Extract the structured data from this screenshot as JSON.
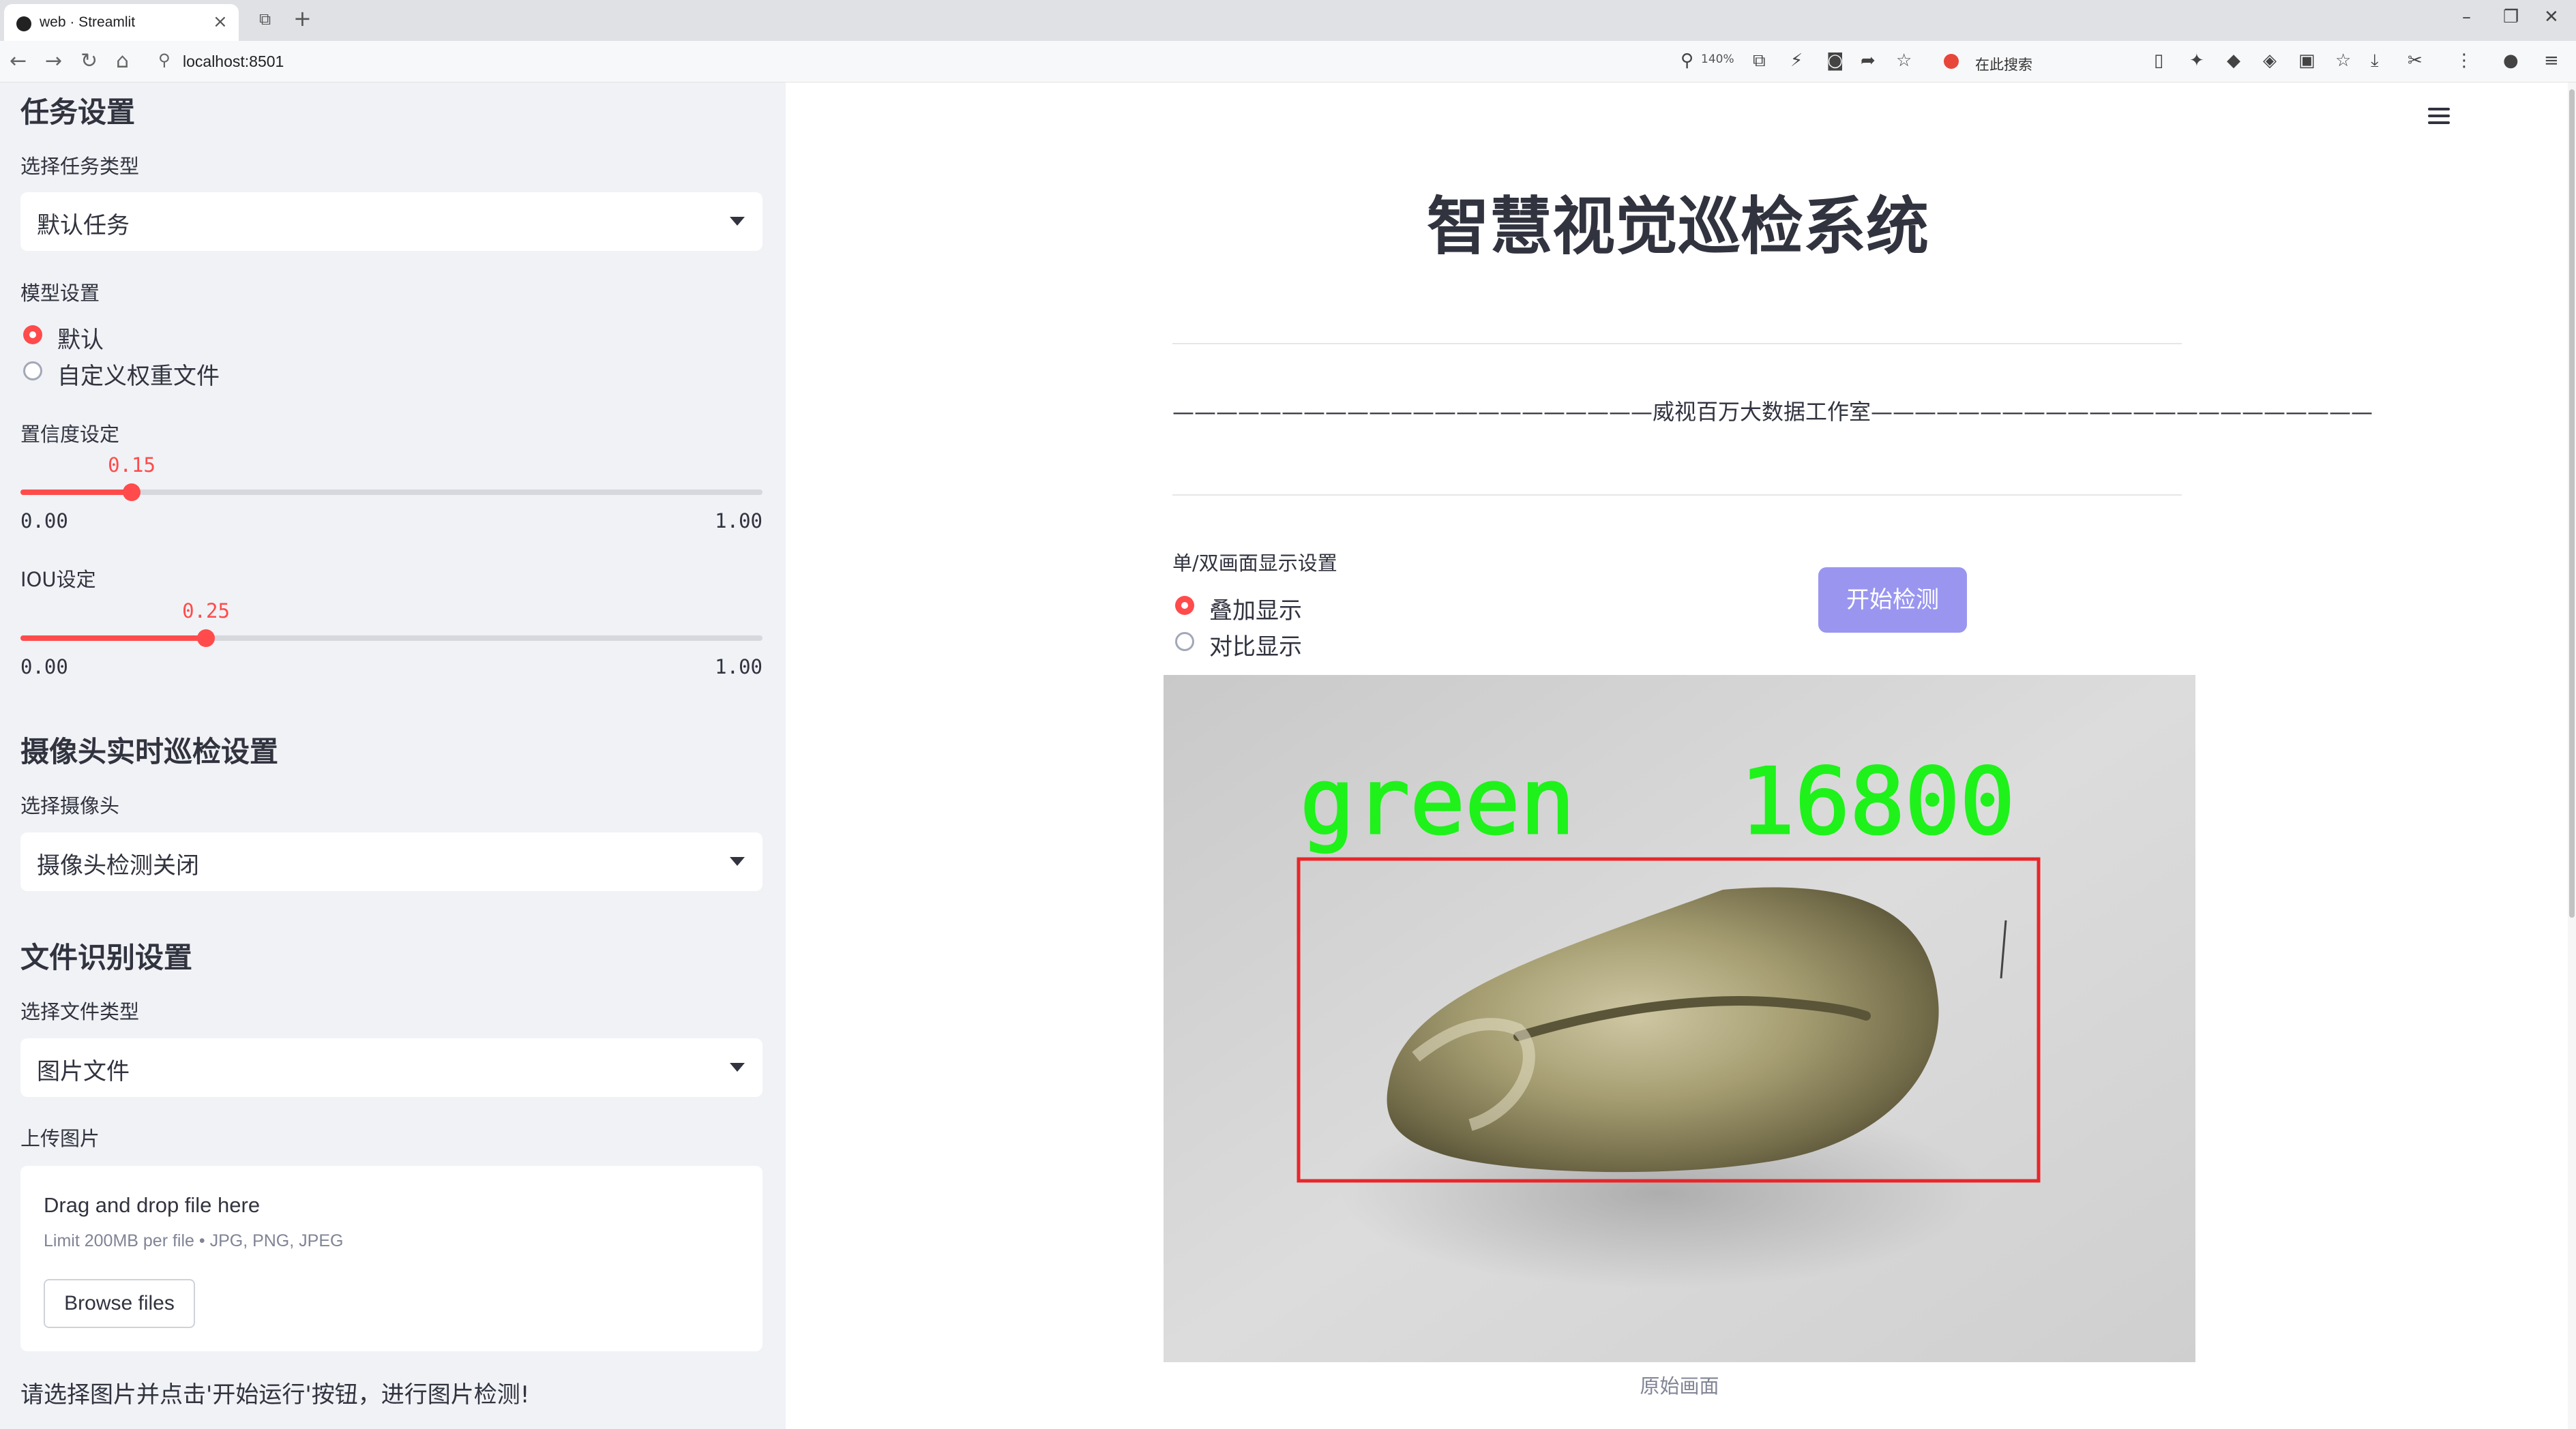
{
  "browser": {
    "tab_title": "web · Streamlit",
    "url": "localhost:8501",
    "zoom": "140%",
    "search_text": "在此搜索"
  },
  "sidebar": {
    "task_heading": "任务设置",
    "task_type_label": "选择任务类型",
    "task_type_value": "默认任务",
    "model_label": "模型设置",
    "model_options": [
      "默认",
      "自定义权重文件"
    ],
    "model_selected": "默认",
    "confidence_label": "置信度设定",
    "confidence": {
      "value": "0.15",
      "min": "0.00",
      "max": "1.00",
      "fraction": 0.15
    },
    "iou_label": "IOU设定",
    "iou": {
      "value": "0.25",
      "min": "0.00",
      "max": "1.00",
      "fraction": 0.25
    },
    "camera_heading": "摄像头实时巡检设置",
    "camera_label": "选择摄像头",
    "camera_value": "摄像头检测关闭",
    "file_heading": "文件识别设置",
    "file_type_label": "选择文件类型",
    "file_type_value": "图片文件",
    "upload_label": "上传图片",
    "uploader": {
      "main_text": "Drag and drop file here",
      "sub_text": "Limit 200MB per file • JPG, PNG, JPEG",
      "button_label": "Browse files"
    },
    "note": "请选择图片并点击'开始运行'按钮，进行图片检测!"
  },
  "main": {
    "title": "智慧视觉巡检系统",
    "subtitle": "——————————————————————威视百万大数据工作室———————————————————————",
    "display_label": "单/双画面显示设置",
    "display_options": [
      "叠加显示",
      "对比显示"
    ],
    "display_selected": "叠加显示",
    "start_button": "开始检测",
    "detection": {
      "label": "green",
      "score": "16800",
      "box_color": "#e8262a",
      "label_color": "#1ef21a"
    },
    "image_caption": "原始画面"
  },
  "colors": {
    "accent": "#ff4b4b",
    "button": "#9a96f0",
    "sidebar_bg": "#f0f2f6"
  }
}
